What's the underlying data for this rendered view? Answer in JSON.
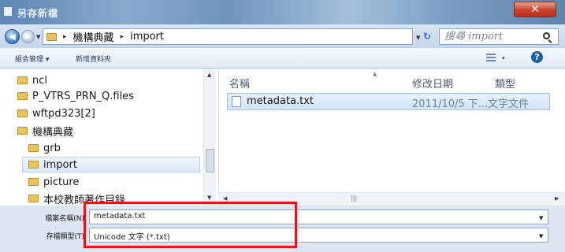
{
  "window": {
    "title": "另存新檔",
    "close_label": "✕"
  },
  "address": {
    "crumbs": [
      "機構典藏",
      "import"
    ],
    "separator": "▸",
    "search_placeholder": "搜尋 import"
  },
  "toolbar": {
    "organize_label": "組合管理 ▾",
    "new_folder_label": "新增資料夾",
    "view_drop": "▾",
    "help_label": "?"
  },
  "nav": {
    "items": [
      {
        "label": "ncl"
      },
      {
        "label": "P_VTRS_PRN_Q.files"
      },
      {
        "label": "wftpd323[2]"
      },
      {
        "label": "機構典藏"
      },
      {
        "label": "grb"
      },
      {
        "label": "import"
      },
      {
        "label": "picture"
      },
      {
        "label": "本校教師著作目錄"
      }
    ]
  },
  "files": {
    "columns": {
      "name": "名稱",
      "date": "修改日期",
      "type": "類型"
    },
    "rows": [
      {
        "name": "metadata.txt",
        "date": "2011/10/5 下...",
        "type": "文字文件"
      }
    ]
  },
  "bottom": {
    "filename_label": "檔案名稱(N):",
    "filename_value": "metadata.txt",
    "filetype_label": "存檔類型(T):",
    "filetype_value": "Unicode 文字 (*.txt)"
  },
  "colors": {
    "highlight": "#e8141c",
    "selection": "#cfe2f8"
  }
}
